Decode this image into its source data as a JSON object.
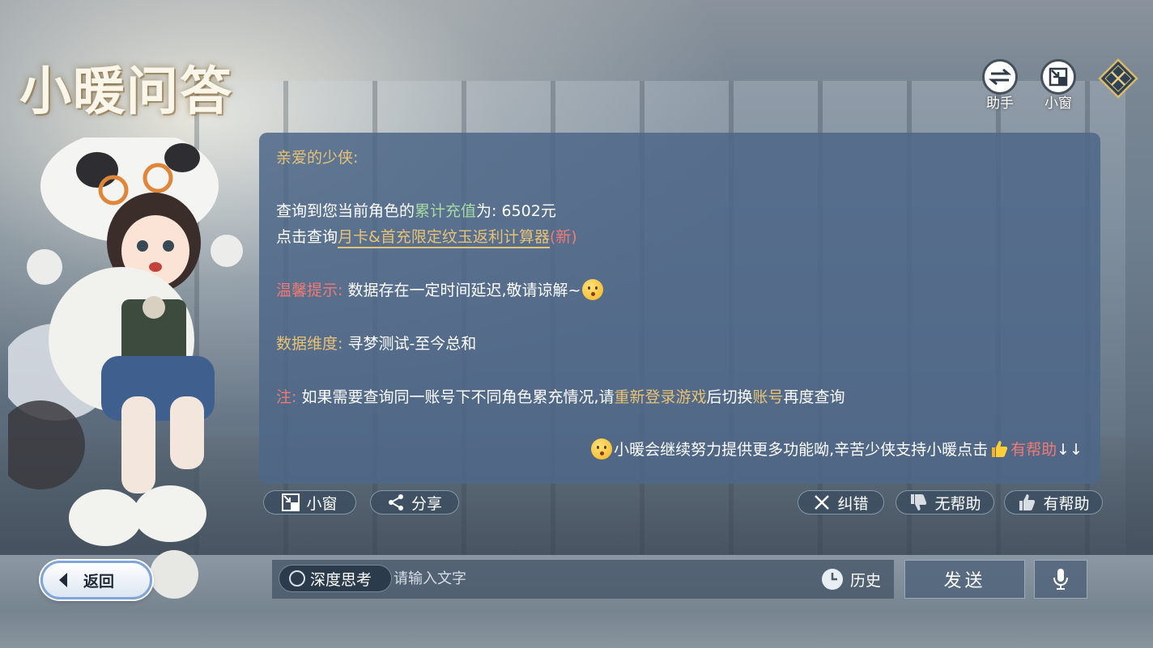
{
  "title": "小暖问答",
  "top_buttons": {
    "assistant_label": "助手",
    "mini_window_label": "小窗"
  },
  "dialog": {
    "greeting": "亲爱的少侠:",
    "query_prefix": "查询到您当前角色的",
    "query_highlight": "累计充值",
    "query_suffix": "为: 6502元",
    "click_prefix": "点击查询",
    "click_link": "月卡&首充限定纹玉返利计算器",
    "click_new": "(新)",
    "tip_label": "温馨提示:",
    "tip_text": " 数据存在一定时间延迟,敬请谅解~",
    "dim_label": "数据维度:",
    "dim_text": " 寻梦测试-至今总和",
    "note_label": "注:",
    "note_text1": " 如果需要查询同一账号下不同角色累充情况,请",
    "note_highlight1": "重新登录游戏",
    "note_text2": "后切换",
    "note_highlight2": "账号",
    "note_text3": "再度查询",
    "footer_text": "小暖会继续努力提供更多功能呦,辛苦少侠支持小暖点击",
    "footer_helpful": "有帮助",
    "footer_arrows": "↓↓"
  },
  "actions": {
    "mini_window": "小窗",
    "share": "分享",
    "report_error": "纠错",
    "not_helpful": "无帮助",
    "helpful": "有帮助"
  },
  "back_button": "返回",
  "input": {
    "deep_think": "深度思考",
    "placeholder": "请输入文字",
    "history": "历史",
    "send": "发送"
  },
  "colors": {
    "gold": "#e8c274",
    "green": "#a6d9a4",
    "red": "#f07a74",
    "dialog_bg": "#4e6888"
  }
}
